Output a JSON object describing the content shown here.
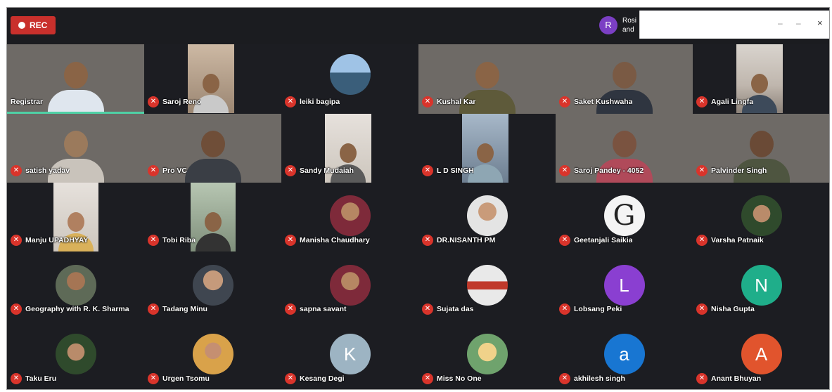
{
  "toolbar": {
    "rec_label": "REC",
    "speaker_initial": "R",
    "speaker_name_line1": "Rosi",
    "speaker_name_line2": "and",
    "minimize_symbol": "–",
    "restore_symbol": "–",
    "close_symbol": "×"
  },
  "colors": {
    "rec_red": "#c9302c",
    "mic_muted_red": "#d9342b",
    "active_speaker_border": "#4fd1a5",
    "avatar_L": "#8a3fd1",
    "avatar_N": "#1fae8a",
    "avatar_K": "#9db4c3",
    "avatar_a": "#1876d2",
    "avatar_A": "#e1542d"
  },
  "participants": [
    {
      "name": "Registrar",
      "muted": false
    },
    {
      "name": "Saroj Reno",
      "muted": true
    },
    {
      "name": "leiki bagipa",
      "muted": true
    },
    {
      "name": "Kushal Kar",
      "muted": true
    },
    {
      "name": "Saket Kushwaha",
      "muted": true
    },
    {
      "name": "Agali Lingfa",
      "muted": true
    },
    {
      "name": "satish yadav",
      "muted": true
    },
    {
      "name": "Pro VC",
      "muted": true
    },
    {
      "name": "Sandy Mudaiah",
      "muted": true
    },
    {
      "name": "L D SINGH",
      "muted": true
    },
    {
      "name": "Saroj Pandey - 4052",
      "muted": true
    },
    {
      "name": "Palvinder Singh",
      "muted": true
    },
    {
      "name": "Manju UPADHYAY",
      "muted": true
    },
    {
      "name": "Tobi Riba",
      "muted": true
    },
    {
      "name": "Manisha Chaudhary",
      "muted": true
    },
    {
      "name": "DR.NISANTH PM",
      "muted": true
    },
    {
      "name": "Geetanjali Saikia",
      "muted": true
    },
    {
      "name": "Varsha Patnaik",
      "muted": true
    },
    {
      "name": "Geography with R. K. Sharma",
      "muted": true
    },
    {
      "name": "Tadang Minu",
      "muted": true
    },
    {
      "name": "sapna savant",
      "muted": true
    },
    {
      "name": "Sujata das",
      "muted": true
    },
    {
      "name": "Lobsang Peki",
      "muted": true,
      "avatar_letter": "L"
    },
    {
      "name": "Nisha Gupta",
      "muted": true,
      "avatar_letter": "N"
    },
    {
      "name": "Taku Eru",
      "muted": true
    },
    {
      "name": "Urgen Tsomu",
      "muted": true
    },
    {
      "name": "Kesang Degi",
      "muted": true,
      "avatar_letter": "K"
    },
    {
      "name": "Miss No One",
      "muted": true
    },
    {
      "name": "akhilesh singh",
      "muted": true,
      "avatar_letter": "a"
    },
    {
      "name": "Anant Bhuyan",
      "muted": true,
      "avatar_letter": "A"
    }
  ],
  "logo_letter": "G"
}
